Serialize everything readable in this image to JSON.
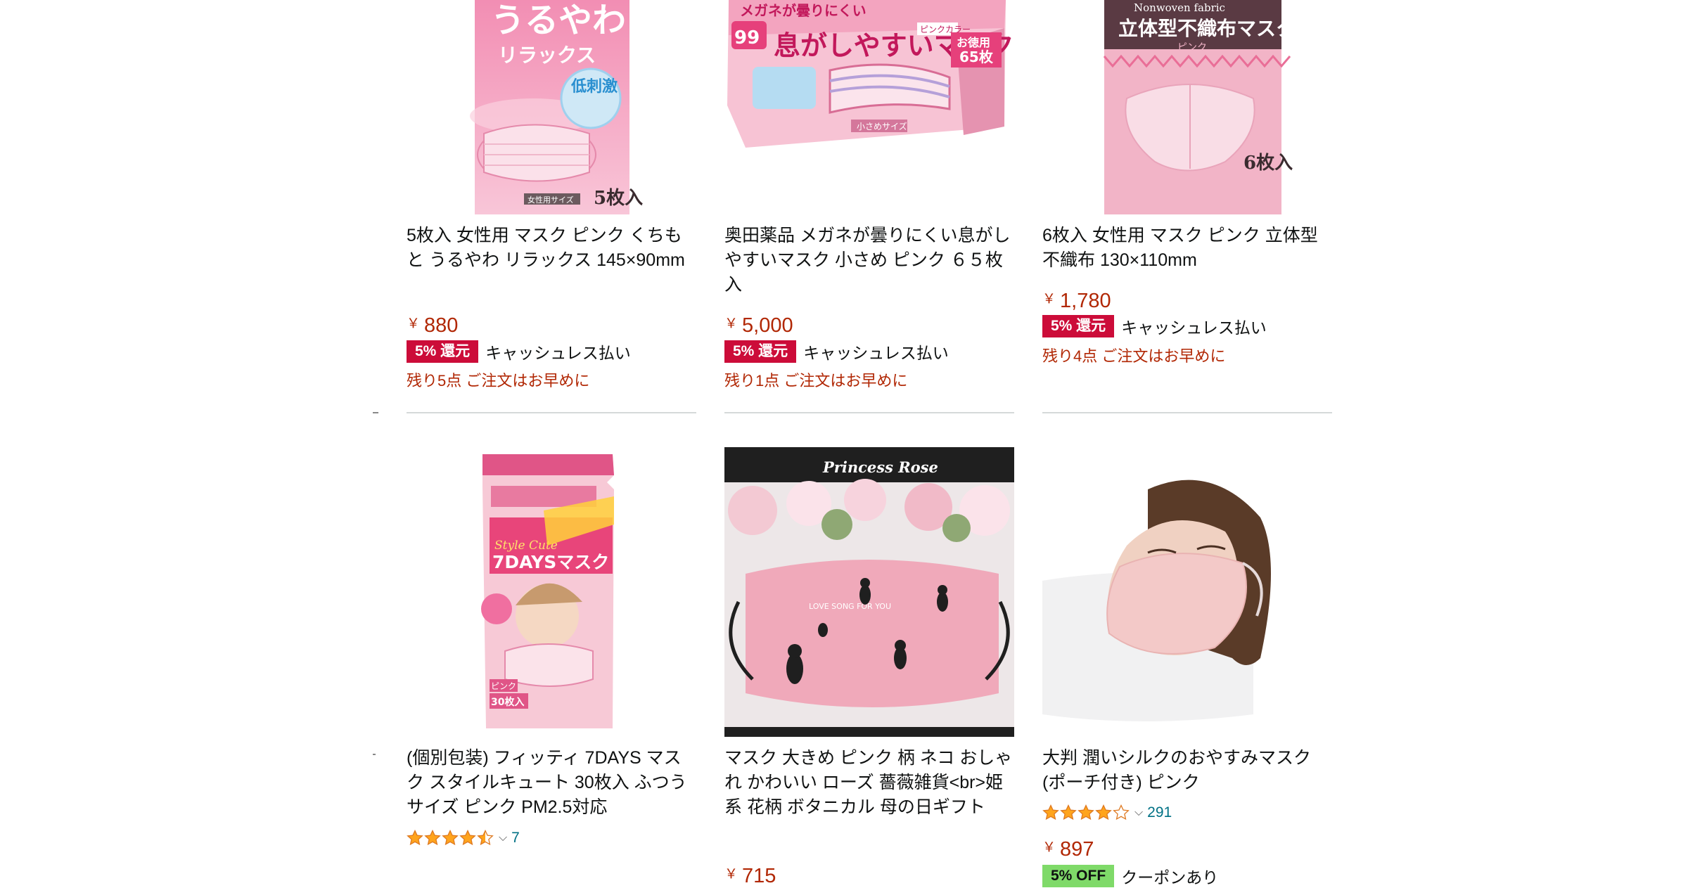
{
  "products": [
    {
      "title": "5枚入 女性用 マスク ピンク くちもと うるやわ リラックス 145×90mm",
      "price": "880",
      "currency": "￥",
      "promo_badge": "5% 還元",
      "promo_text": "キャッシュレス払い",
      "stock": "残り5点 ご注文はお早めに",
      "pkg_text": {
        "line1": "うるやわ",
        "line2": "リラックス",
        "bubble": "低刺激",
        "count": "5枚入",
        "size": "女性用サイズ"
      }
    },
    {
      "title": "奥田薬品 メガネが曇りにくい息がしやすいマスク 小さめ ピンク ６５枚入",
      "price": "5,000",
      "currency": "￥",
      "promo_badge": "5% 還元",
      "promo_text": "キャッシュレス払い",
      "stock": "残り1点 ご注文はお早めに",
      "pkg_text": {
        "line1": "息がしやすいマスク",
        "top": "メガネが曇りにくい",
        "corner": "お徳用",
        "count": "65枚",
        "label": "ピンクカラー",
        "small": "小さめサイズ",
        "pct": "99"
      }
    },
    {
      "title": "6枚入 女性用 マスク ピンク 立体型 不織布 130×110mm",
      "price": "1,780",
      "currency": "￥",
      "promo_badge": "5% 還元",
      "promo_text": "キャッシュレス払い",
      "stock": "残り4点 ご注文はお早めに",
      "pkg_text": {
        "top": "Nonwoven fabric",
        "line1": "立体型不織布マスク",
        "line2": "ピンク",
        "count": "6枚入"
      }
    },
    {
      "title": "(個別包装) フィッティ 7DAYS マスク スタイルキュート 30枚入 ふつうサイズ ピンク PM2.5対応",
      "rating_value": 4.5,
      "rating_count": "7",
      "pkg_text": {
        "line1": "7DAYSマスク",
        "tag": "ピンク",
        "count": "30枚入",
        "script": "Style Cute"
      }
    },
    {
      "title": "マスク 大きめ ピンク 柄 ネコ おしゃれ かわいい ローズ 薔薇雑貨<br>姫系 花柄 ボタニカル 母の日ギフト",
      "price": "715",
      "currency": "￥",
      "pkg_text": {
        "banner": "Princess Rose",
        "mask_text": "LOVE SONG FOR YOU"
      }
    },
    {
      "title": "大判 潤いシルクのおやすみマスク(ポーチ付き) ピンク",
      "rating_value": 4.0,
      "rating_count": "291",
      "price": "897",
      "currency": "￥",
      "promo_badge": "5% OFF",
      "promo_text": "クーポンあり"
    }
  ],
  "colors": {
    "price": "#b12704",
    "badge_red": "#cc0c39",
    "badge_green": "#7fda69",
    "link": "#007185",
    "star": "#ffa41c"
  },
  "icons": {
    "star": "star-icon",
    "chevron": "chevron-down-icon"
  }
}
